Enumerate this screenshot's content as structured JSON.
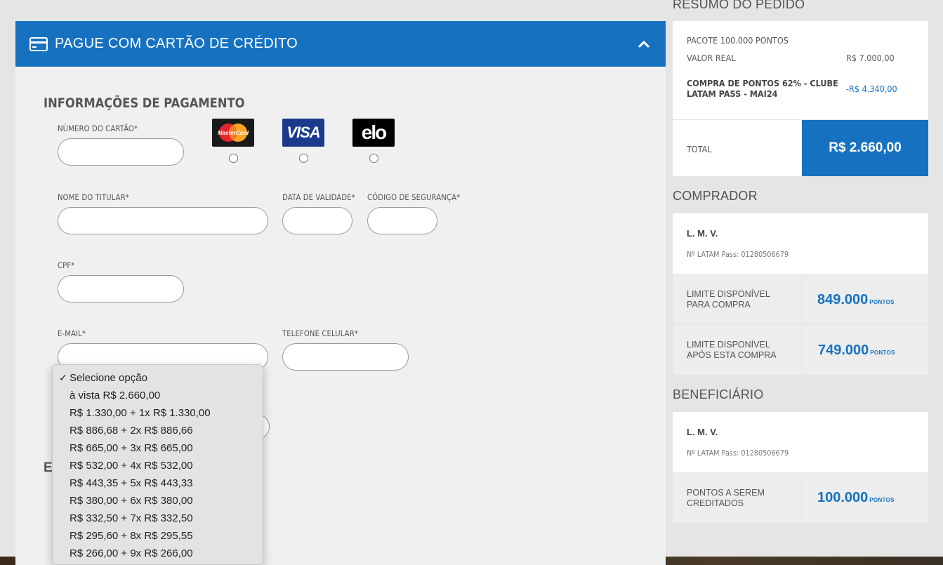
{
  "payment": {
    "header_title": "PAGUE COM CARTÃO DE CRÉDITO",
    "section_title": "INFORMAÇÕES DE PAGAMENTO",
    "card_number_label": "NÚMERO DO CARTÃO*",
    "brands": [
      {
        "name": "MasterCard"
      },
      {
        "name": "VISA"
      },
      {
        "name": "elo"
      }
    ],
    "holder_label": "NOME DO TITULAR*",
    "expiry_label": "DATA DE VALIDADE*",
    "security_label": "CÓDIGO DE SEGURANÇA*",
    "cpf_label": "CPF*",
    "email_label": "E-MAIL*",
    "phone_label": "TELEFONE CELULAR*",
    "partial_heading": "E"
  },
  "installments_dropdown": {
    "selected": "Selecione opção",
    "options": [
      "Selecione opção",
      "à vista R$ 2.660,00",
      "R$ 1.330,00 + 1x R$ 1.330,00",
      "R$ 886,68 + 2x R$ 886,66",
      "R$ 665,00 + 3x R$ 665,00",
      "R$ 532,00 + 4x R$ 532,00",
      "R$ 443,35 + 5x R$ 443,33",
      "R$ 380,00 + 6x R$ 380,00",
      "R$ 332,50 + 7x R$ 332,50",
      "R$ 295,60 + 8x R$ 295,55",
      "R$ 266,00 + 9x R$ 266,00"
    ]
  },
  "summary": {
    "heading": "RESUMO DO PEDIDO",
    "package": "PACOTE 100.000 PONTOS",
    "real_value_label": "VALOR REAL",
    "real_value": "R$ 7.000,00",
    "discount_label_line1": "COMPRA DE PONTOS 62% - CLUBE",
    "discount_label_line2": "LATAM PASS - MAI24",
    "discount_value": "-R$ 4.340,00",
    "total_label": "TOTAL",
    "total_value": "R$ 2.660,00"
  },
  "buyer": {
    "heading": "COMPRADOR",
    "name": "L. M. V.",
    "latam_pass": "Nº LATAM Pass: 01280506679",
    "limit_label_line1": "LIMITE DISPONÍVEL",
    "limit_label_line2": "PARA COMPRA",
    "limit_value": "849.000",
    "after_label_line1": "LIMITE DISPONÍVEL",
    "after_label_line2": "APÓS ESTA COMPRA",
    "after_value": "749.000",
    "unit": "PONTOS"
  },
  "beneficiary": {
    "heading": "BENEFICIÁRIO",
    "name": "L. M. V.",
    "latam_pass": "Nº LATAM Pass: 01280506679",
    "points_label_line1": "PONTOS A SEREM",
    "points_label_line2": "CREDITADOS",
    "points_value": "100.000",
    "unit": "PONTOS"
  },
  "colors": {
    "brand_blue": "#1672c0",
    "background": "#e5e5e5"
  }
}
